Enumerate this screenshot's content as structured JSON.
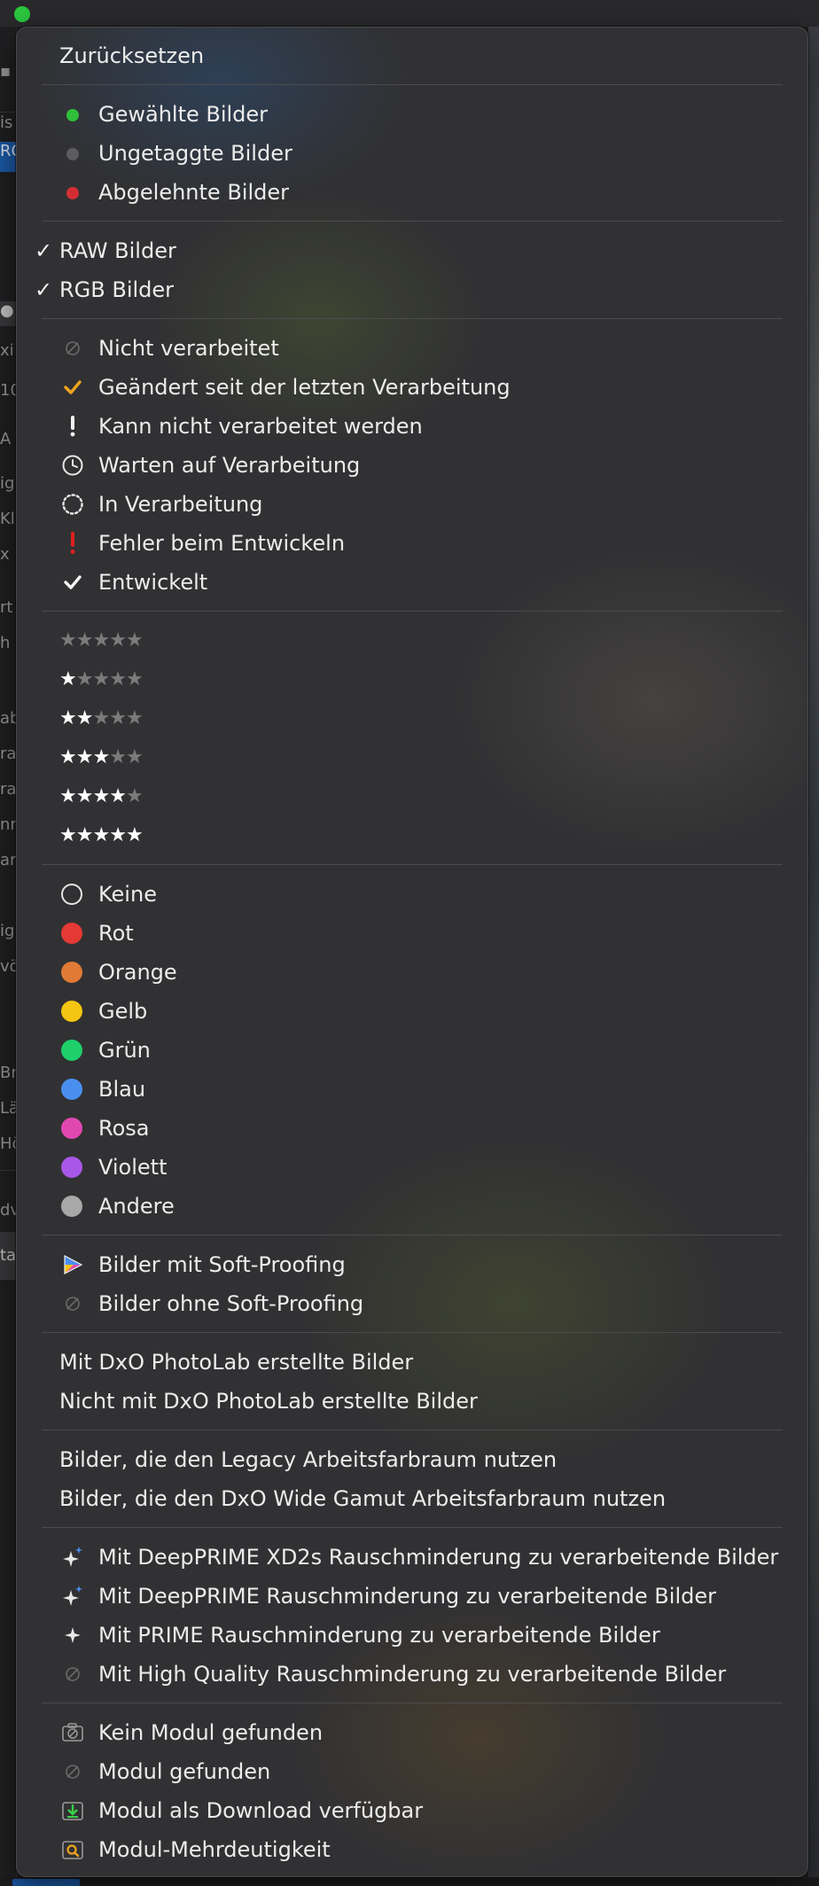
{
  "menu": {
    "reset": "Zurücksetzen",
    "picks": [
      {
        "label": "Gewählte Bilder",
        "color": "#2fbf3a"
      },
      {
        "label": "Ungetaggte Bilder",
        "color": "#5c5c5e"
      },
      {
        "label": "Abgelehnte Bilder",
        "color": "#d32f33"
      }
    ],
    "formats": [
      {
        "label": "RAW Bilder",
        "checked": "✓"
      },
      {
        "label": "RGB Bilder",
        "checked": "✓"
      }
    ],
    "processing": [
      {
        "label": "Nicht verarbeitet",
        "icon": "not-processed-icon"
      },
      {
        "label": "Geändert seit der letzten Verarbeitung",
        "icon": "modified-check-icon"
      },
      {
        "label": "Kann nicht verarbeitet werden",
        "icon": "exclamation-icon"
      },
      {
        "label": "Warten auf Verarbeitung",
        "icon": "clock-icon"
      },
      {
        "label": "In Verarbeitung",
        "icon": "spinner-icon"
      },
      {
        "label": "Fehler beim Entwickeln",
        "icon": "error-exclamation-icon"
      },
      {
        "label": "Entwickelt",
        "icon": "developed-check-icon"
      }
    ],
    "ratings": [
      0,
      1,
      2,
      3,
      4,
      5
    ],
    "colors": [
      {
        "label": "Keine",
        "color": "none"
      },
      {
        "label": "Rot",
        "color": "#e53935"
      },
      {
        "label": "Orange",
        "color": "#e07a35"
      },
      {
        "label": "Gelb",
        "color": "#f4c511"
      },
      {
        "label": "Grün",
        "color": "#1ecf6a"
      },
      {
        "label": "Blau",
        "color": "#4a8ff0"
      },
      {
        "label": "Rosa",
        "color": "#e048b0"
      },
      {
        "label": "Violett",
        "color": "#a857e6"
      },
      {
        "label": "Andere",
        "color": "#a8a8a8"
      }
    ],
    "softproof": [
      {
        "label": "Bilder mit Soft-Proofing",
        "icon": "soft-proofing-icon"
      },
      {
        "label": "Bilder ohne Soft-Proofing",
        "icon": "no-soft-proofing-icon"
      }
    ],
    "created": [
      "Mit DxO PhotoLab erstellte Bilder",
      "Nicht mit DxO PhotoLab erstellte Bilder"
    ],
    "colorspace": [
      "Bilder, die den Legacy Arbeitsfarbraum nutzen",
      "Bilder, die den DxO Wide Gamut Arbeitsfarbraum nutzen"
    ],
    "denoise": [
      {
        "label": "Mit DeepPRIME XD2s Rauschminderung zu verarbeitende Bilder",
        "icon": "sparkle-blue-icon"
      },
      {
        "label": "Mit DeepPRIME Rauschminderung zu verarbeitende Bilder",
        "icon": "sparkle-blue-icon"
      },
      {
        "label": "Mit PRIME Rauschminderung zu verarbeitende Bilder",
        "icon": "sparkle-icon"
      },
      {
        "label": "Mit High Quality Rauschminderung zu verarbeitende Bilder",
        "icon": "not-applicable-icon"
      }
    ],
    "modules": [
      {
        "label": "Kein Modul gefunden",
        "icon": "no-module-camera-icon"
      },
      {
        "label": "Modul gefunden",
        "icon": "not-applicable-icon"
      },
      {
        "label": "Modul als Download verfügbar",
        "icon": "download-icon"
      },
      {
        "label": "Modul-Mehrdeutigkeit",
        "icon": "ambiguity-search-icon"
      }
    ]
  }
}
